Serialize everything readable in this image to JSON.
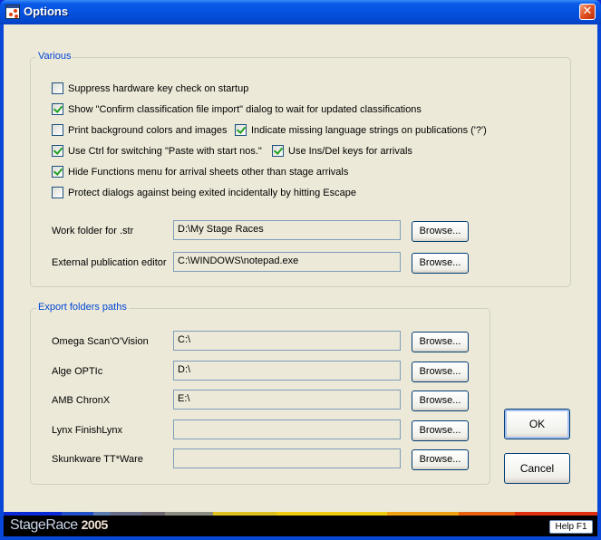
{
  "window": {
    "title": "Options",
    "close_glyph": "✕"
  },
  "various": {
    "label": "Various",
    "options": [
      {
        "label": "Suppress hardware key check on startup",
        "checked": false
      },
      {
        "label": "Show \"Confirm classification file import\" dialog to wait for updated classifications",
        "checked": true
      },
      {
        "label": "Print background colors and images",
        "checked": false
      },
      {
        "label": "Indicate missing language strings on publications ('?')",
        "checked": true
      },
      {
        "label": "Use Ctrl for switching \"Paste with start nos.\"",
        "checked": true
      },
      {
        "label": "Use Ins/Del keys for arrivals",
        "checked": true
      },
      {
        "label": "Hide Functions menu for arrival sheets other than stage arrivals",
        "checked": true
      },
      {
        "label": "Protect dialogs against being exited incidentally by hitting Escape",
        "checked": false
      }
    ],
    "work_folder": {
      "label": "Work folder for .str",
      "value": "D:\\My Stage Races",
      "button": "Browse..."
    },
    "external_editor": {
      "label": "External publication editor",
      "value": "C:\\WINDOWS\\notepad.exe",
      "button": "Browse..."
    }
  },
  "export": {
    "label": "Export folders paths",
    "rows": [
      {
        "label": "Omega Scan'O'Vision",
        "value": "C:\\",
        "button": "Browse..."
      },
      {
        "label": "Alge OPTIc",
        "value": "D:\\",
        "button": "Browse..."
      },
      {
        "label": "AMB ChronX",
        "value": "E:\\",
        "button": "Browse..."
      },
      {
        "label": "Lynx FinishLynx",
        "value": "",
        "button": "Browse..."
      },
      {
        "label": "Skunkware TT*Ware",
        "value": "",
        "button": "Browse..."
      }
    ]
  },
  "buttons": {
    "ok": "OK",
    "cancel": "Cancel"
  },
  "footer": {
    "brand": "StageRace",
    "year": "2005",
    "help": "Help F1",
    "stripe_colors": [
      "#0a2ad8",
      "#2250c8",
      "#5b7ab0",
      "#6a6e88",
      "#706870",
      "#8c8c80",
      "#e0c020",
      "#f0cc10",
      "#f0a010",
      "#e86010",
      "#e03010"
    ]
  }
}
